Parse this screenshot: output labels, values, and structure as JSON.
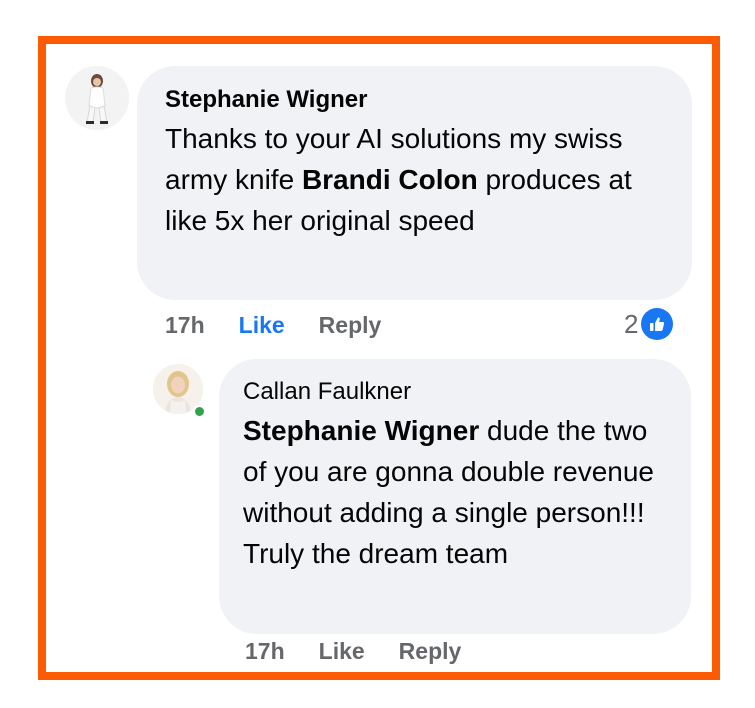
{
  "comment": {
    "author": "Stephanie Wigner",
    "text_before": "Thanks to your AI solutions my swiss army knife ",
    "mention": "Brandi Colon",
    "text_after": " produces at like 5x her original speed",
    "time": "17h",
    "like_label": "Like",
    "reply_label": "Reply",
    "reaction_count": "2",
    "reaction_icon": "thumbs-up-icon",
    "liked_color": "#1877f2"
  },
  "reply": {
    "author": "Callan Faulkner",
    "mention": "Stephanie Wigner",
    "text_after": " dude the two of you are gonna double revenue without adding a single person!!! Truly the dream team",
    "time": "17h",
    "like_label": "Like",
    "reply_label": "Reply",
    "online_status_color": "#31a24c"
  },
  "frame_color": "#fc5a03"
}
